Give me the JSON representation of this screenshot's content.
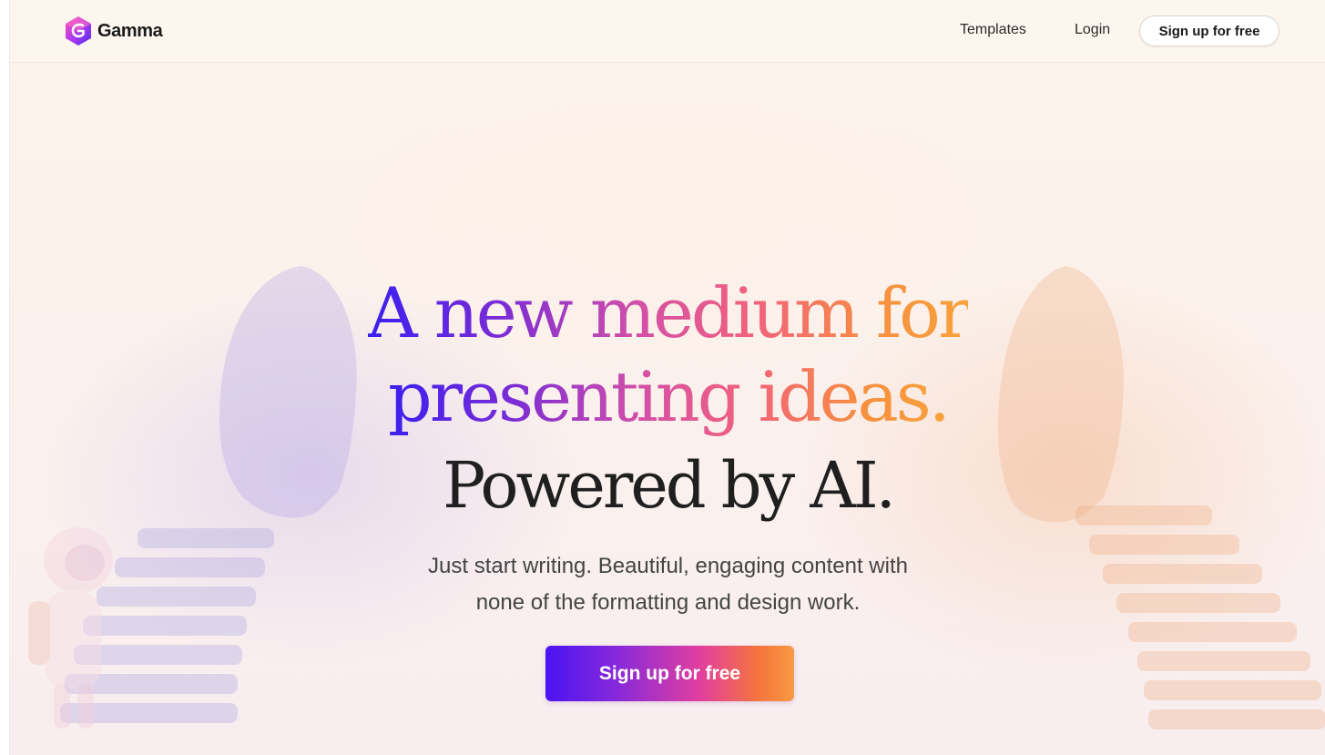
{
  "brand": {
    "name": "Gamma",
    "logo_icon": "gamma-logo-icon",
    "accent_colors": [
      "#3b1ff0",
      "#7a2cd6",
      "#d44fa8",
      "#f2637a",
      "#f7903f"
    ]
  },
  "nav": {
    "templates": "Templates",
    "login": "Login",
    "signup": "Sign up for free"
  },
  "hero": {
    "title_line1": "A new medium for",
    "title_line2": "presenting ideas.",
    "subtitle": "Powered by AI.",
    "desc_line1": "Just start writing. Beautiful, engaging content with",
    "desc_line2": "none of the formatting and design work.",
    "cta": "Sign up for free"
  }
}
